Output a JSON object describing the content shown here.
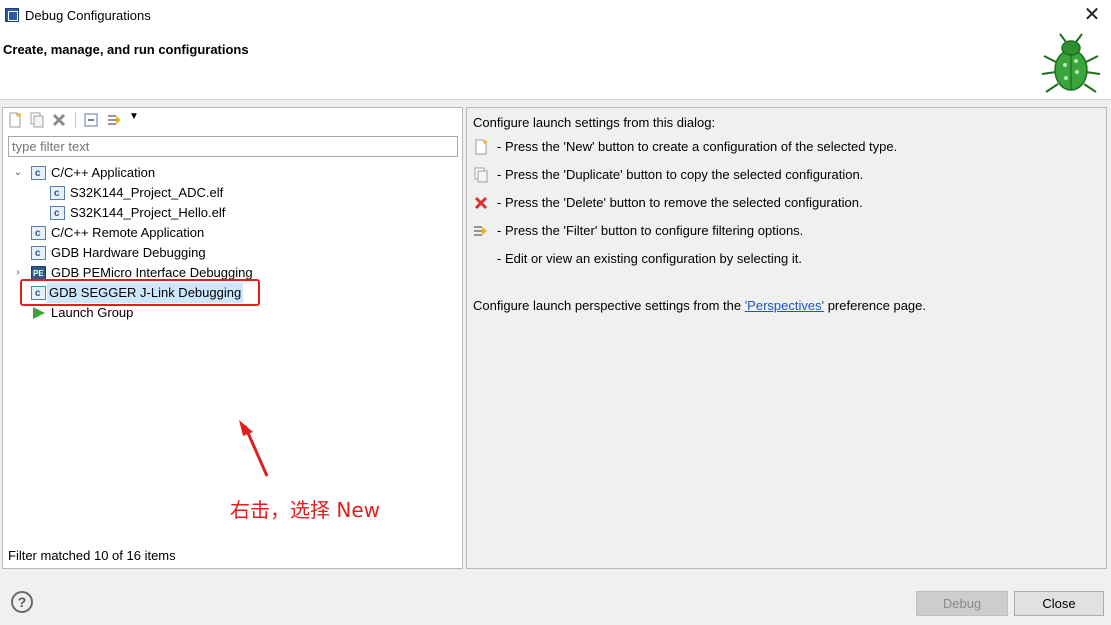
{
  "window": {
    "title": "Debug Configurations"
  },
  "header": {
    "title": "Create, manage, and run configurations"
  },
  "left": {
    "filter_placeholder": "type filter text",
    "tree": [
      {
        "label": "C/C++ Application",
        "expanded": true,
        "icon": "c-config-icon"
      },
      {
        "label": "S32K144_Project_ADC.elf",
        "icon": "c-config-icon",
        "level": 1
      },
      {
        "label": "S32K144_Project_Hello.elf",
        "icon": "c-config-icon",
        "level": 1
      },
      {
        "label": "C/C++ Remote Application",
        "icon": "c-config-icon"
      },
      {
        "label": "GDB Hardware Debugging",
        "icon": "c-config-icon"
      },
      {
        "label": "GDB PEMicro Interface Debugging",
        "icon": "pemicro-icon",
        "expandable": true
      },
      {
        "label": "GDB SEGGER J-Link Debugging",
        "icon": "c-config-icon",
        "selected": true
      },
      {
        "label": "Launch Group",
        "icon": "launch-group-icon"
      }
    ],
    "status": "Filter matched 10 of 16 items"
  },
  "right": {
    "intro": "Configure launch settings from this dialog:",
    "lines": [
      {
        "icon": "new-icon",
        "text": "- Press the 'New' button to create a configuration of the selected type."
      },
      {
        "icon": "duplicate-icon",
        "text": "- Press the 'Duplicate' button to copy the selected configuration."
      },
      {
        "icon": "delete-icon",
        "text": "- Press the 'Delete' button to remove the selected configuration."
      },
      {
        "icon": "filter-icon",
        "text": "- Press the 'Filter' button to configure filtering options."
      },
      {
        "icon": "",
        "text": "- Edit or view an existing configuration by selecting it."
      }
    ],
    "perspectives_prefix": "Configure launch perspective settings from the ",
    "perspectives_link": "'Perspectives'",
    "perspectives_suffix": " preference page."
  },
  "annotation": {
    "text": "右击，选择 New",
    "color": "#e02020"
  },
  "buttons": {
    "debug": "Debug",
    "close": "Close",
    "help": "?"
  }
}
